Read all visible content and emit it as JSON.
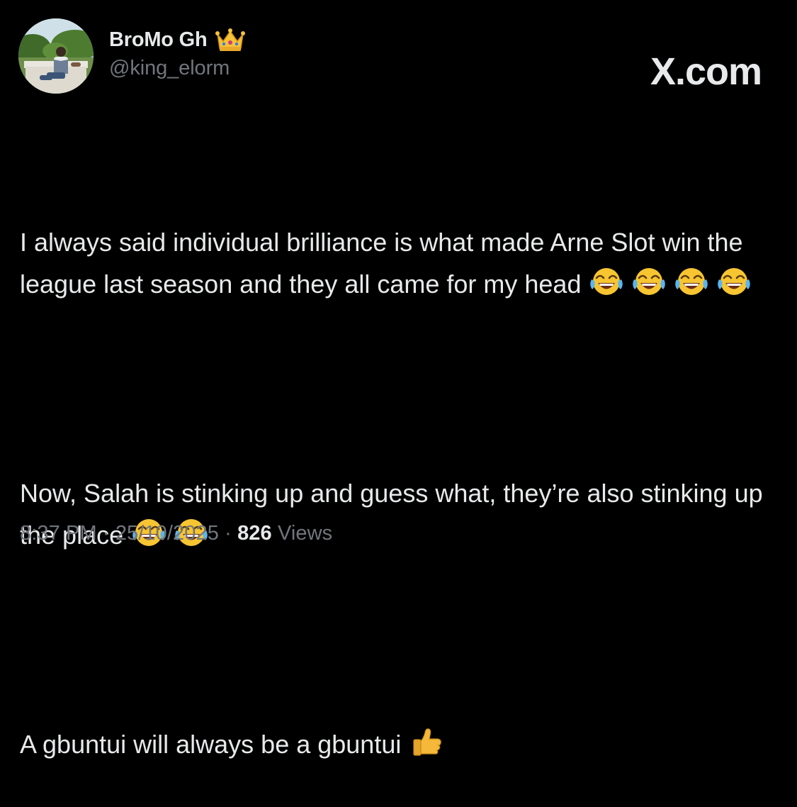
{
  "author": {
    "display_name": "BroMo Gh",
    "badge_icon": "crown-icon",
    "handle": "@king_elorm"
  },
  "site_mark": "X.com",
  "post": {
    "paragraphs": [
      {
        "text": "I always said individual brilliance is what made Arne Slot win the league last season and they all came for my head",
        "emoji": [
          "face-with-tears-of-joy-icon",
          "face-with-tears-of-joy-icon",
          "face-with-tears-of-joy-icon",
          "face-with-tears-of-joy-icon"
        ]
      },
      {
        "text": "Now, Salah is stinking up and guess what, they’re also stinking up the place",
        "emoji": [
          "face-with-tears-of-joy-icon",
          "face-with-tears-of-joy-icon"
        ]
      },
      {
        "text": "A gbuntui will always be a gbuntui",
        "emoji": [
          "thumbs-up-icon"
        ]
      }
    ]
  },
  "meta": {
    "time": "8:37 PM",
    "separator": "·",
    "date": "25/10/2025",
    "views_count": "826",
    "views_label": "Views"
  },
  "colors": {
    "background": "#000000",
    "primary_text": "#e7e9ea",
    "secondary_text": "#71767b"
  }
}
